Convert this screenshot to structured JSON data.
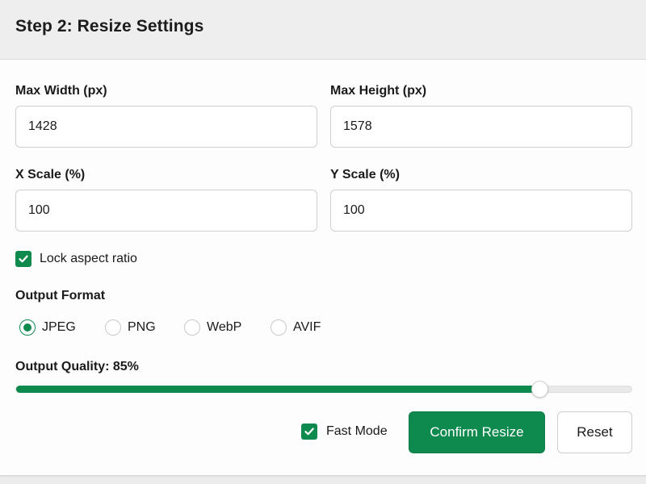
{
  "header": {
    "title": "Step 2: Resize Settings"
  },
  "fields": {
    "max_width": {
      "label": "Max Width (px)",
      "value": "1428"
    },
    "max_height": {
      "label": "Max Height (px)",
      "value": "1578"
    },
    "x_scale": {
      "label": "X Scale (%)",
      "value": "100"
    },
    "y_scale": {
      "label": "Y Scale (%)",
      "value": "100"
    }
  },
  "lock_aspect": {
    "label": "Lock aspect ratio",
    "checked": true
  },
  "output_format": {
    "label": "Output Format",
    "options": [
      "JPEG",
      "PNG",
      "WebP",
      "AVIF"
    ],
    "selected": "JPEG"
  },
  "quality": {
    "label": "Output Quality: 85%",
    "value_percent": 85
  },
  "fast_mode": {
    "label": "Fast Mode",
    "checked": true
  },
  "actions": {
    "confirm_label": "Confirm Resize",
    "reset_label": "Reset"
  },
  "colors": {
    "accent": "#0e8a4f",
    "header_bg": "#eeeeee"
  }
}
